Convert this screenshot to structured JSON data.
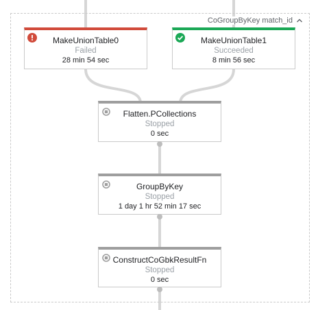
{
  "composite": {
    "label": "CoGroupByKey match_id",
    "collapse_icon": "chevron-up-icon"
  },
  "nodes": [
    {
      "id": "make-union-table-0",
      "name": "MakeUnionTable0",
      "status": "Failed",
      "duration": "28 min 54 sec",
      "state": "failed",
      "icon": "error-icon",
      "color": "#d14b3b"
    },
    {
      "id": "make-union-table-1",
      "name": "MakeUnionTable1",
      "status": "Succeeded",
      "duration": "8 min 56 sec",
      "state": "succeeded",
      "icon": "check-circle-icon",
      "color": "#1ba856"
    },
    {
      "id": "flatten-pcollections",
      "name": "Flatten.PCollections",
      "status": "Stopped",
      "duration": "0 sec",
      "state": "stopped",
      "icon": "stop-icon",
      "color": "#9e9e9e"
    },
    {
      "id": "group-by-key",
      "name": "GroupByKey",
      "status": "Stopped",
      "duration": "1 day 1 hr 52 min 17 sec",
      "state": "stopped",
      "icon": "stop-icon",
      "color": "#9e9e9e"
    },
    {
      "id": "construct-cogbk-result-fn",
      "name": "ConstructCoGbkResultFn",
      "status": "Stopped",
      "duration": "0 sec",
      "state": "stopped",
      "icon": "stop-icon",
      "color": "#9e9e9e"
    }
  ]
}
